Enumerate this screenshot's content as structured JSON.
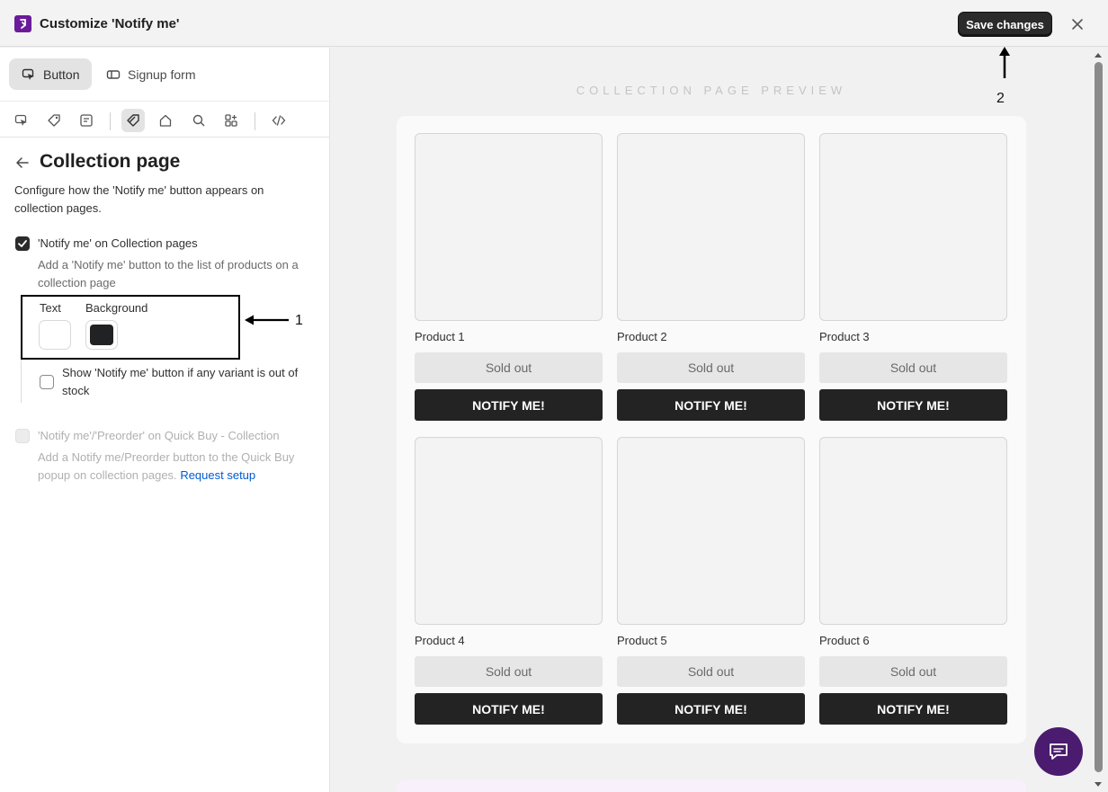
{
  "window": {
    "title": "Customize 'Notify me'",
    "save_label": "Save changes",
    "close_icon": "close-icon",
    "app_icon": "app-logo-icon"
  },
  "tabs": [
    {
      "label": "Button",
      "icon": "cursor-click-icon",
      "active": true
    },
    {
      "label": "Signup form",
      "icon": "signup-form-icon",
      "active": false
    }
  ],
  "toolbar_icons": [
    "cursor-icon",
    "tag-icon",
    "product-card-icon",
    "collection-tag-icon",
    "home-icon",
    "search-icon",
    "apps-icon",
    "code-icon"
  ],
  "section": {
    "title": "Collection page",
    "description": "Configure how the 'Notify me' button appears on collection pages."
  },
  "option1": {
    "label": "'Notify me' on Collection pages",
    "checked": true,
    "hint": "Add a 'Notify me' button to the list of products on a collection page"
  },
  "colors": {
    "text_label": "Text",
    "background_label": "Background",
    "text_color": "#ffffff",
    "background_color": "#202223"
  },
  "option2": {
    "label": "Show 'Notify me' button if any variant is out of stock",
    "checked": false
  },
  "option3": {
    "label": "'Notify me'/'Preorder' on Quick Buy - Collection",
    "disabled": true,
    "hint": "Add a Notify me/Preorder button to the Quick Buy popup on collection pages.",
    "link": "Request setup"
  },
  "annotations": {
    "one": "1",
    "two": "2"
  },
  "preview": {
    "title": "COLLECTION PAGE PREVIEW",
    "products": [
      {
        "name": "Product 1",
        "status": "Sold out",
        "button": "NOTIFY ME!"
      },
      {
        "name": "Product 2",
        "status": "Sold out",
        "button": "NOTIFY ME!"
      },
      {
        "name": "Product 3",
        "status": "Sold out",
        "button": "NOTIFY ME!"
      },
      {
        "name": "Product 4",
        "status": "Sold out",
        "button": "NOTIFY ME!"
      },
      {
        "name": "Product 5",
        "status": "Sold out",
        "button": "NOTIFY ME!"
      },
      {
        "name": "Product 6",
        "status": "Sold out",
        "button": "NOTIFY ME!"
      }
    ]
  },
  "chat_icon": "chat-icon"
}
